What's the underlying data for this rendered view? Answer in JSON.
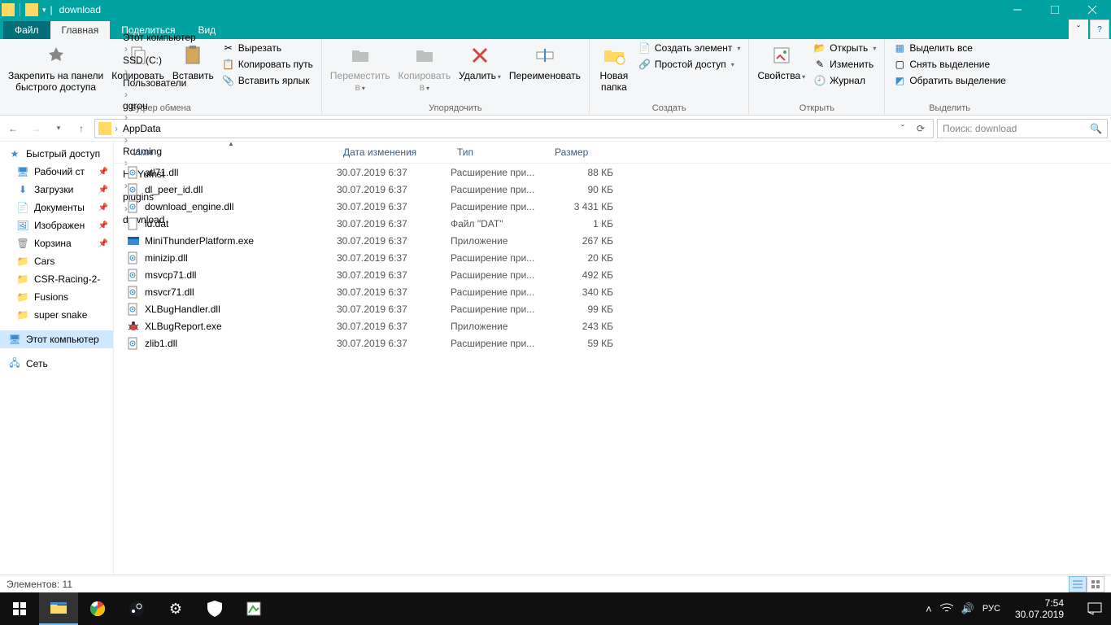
{
  "window": {
    "title": "download"
  },
  "tabs": {
    "file": "Файл",
    "home": "Главная",
    "share": "Поделиться",
    "view": "Вид"
  },
  "ribbon": {
    "clipboard": {
      "label": "Буфер обмена",
      "pin": "Закрепить на панели\nбыстрого доступа",
      "copy": "Копировать",
      "paste": "Вставить",
      "cut": "Вырезать",
      "copypath": "Копировать путь",
      "pasteshortcut": "Вставить ярлык"
    },
    "organize": {
      "label": "Упорядочить",
      "moveto": "Переместить\nв",
      "copyto": "Копировать\nв",
      "delete": "Удалить",
      "rename": "Переименовать"
    },
    "new": {
      "label": "Создать",
      "newfolder": "Новая\nпапка",
      "newitem": "Создать элемент",
      "easyaccess": "Простой доступ"
    },
    "open": {
      "label": "Открыть",
      "properties": "Свойства",
      "open": "Открыть",
      "edit": "Изменить",
      "history": "Журнал"
    },
    "select": {
      "label": "Выделить",
      "selectall": "Выделить все",
      "selectnone": "Снять выделение",
      "invert": "Обратить выделение"
    }
  },
  "breadcrumbs": [
    "Этот компьютер",
    "SSD (C:)",
    "Пользователи",
    "ggrou",
    "AppData",
    "Roaming",
    "HaiYuInst",
    "plugins",
    "download"
  ],
  "search": {
    "placeholder": "Поиск: download"
  },
  "sidebar": {
    "quickaccess": "Быстрый доступ",
    "items": [
      {
        "label": "Рабочий ст",
        "icon": "desktop",
        "pinned": true
      },
      {
        "label": "Загрузки",
        "icon": "downloads",
        "pinned": true
      },
      {
        "label": "Документы",
        "icon": "documents",
        "pinned": true
      },
      {
        "label": "Изображен",
        "icon": "pictures",
        "pinned": true
      },
      {
        "label": "Корзина",
        "icon": "recycle",
        "pinned": true
      },
      {
        "label": "Cars",
        "icon": "folder",
        "pinned": false
      },
      {
        "label": "CSR-Racing-2-",
        "icon": "folder",
        "pinned": false
      },
      {
        "label": "Fusions",
        "icon": "folder",
        "pinned": false
      },
      {
        "label": "super snake",
        "icon": "folder",
        "pinned": false
      }
    ],
    "thispc": "Этот компьютер",
    "network": "Сеть"
  },
  "columns": {
    "name": "Имя",
    "date": "Дата изменения",
    "type": "Тип",
    "size": "Размер"
  },
  "files": [
    {
      "name": "atl71.dll",
      "date": "30.07.2019 6:37",
      "type": "Расширение при...",
      "size": "88 КБ",
      "icon": "dll"
    },
    {
      "name": "dl_peer_id.dll",
      "date": "30.07.2019 6:37",
      "type": "Расширение при...",
      "size": "90 КБ",
      "icon": "dll"
    },
    {
      "name": "download_engine.dll",
      "date": "30.07.2019 6:37",
      "type": "Расширение при...",
      "size": "3 431 КБ",
      "icon": "dll"
    },
    {
      "name": "id.dat",
      "date": "30.07.2019 6:37",
      "type": "Файл \"DAT\"",
      "size": "1 КБ",
      "icon": "dat"
    },
    {
      "name": "MiniThunderPlatform.exe",
      "date": "30.07.2019 6:37",
      "type": "Приложение",
      "size": "267 КБ",
      "icon": "exe-blue"
    },
    {
      "name": "minizip.dll",
      "date": "30.07.2019 6:37",
      "type": "Расширение при...",
      "size": "20 КБ",
      "icon": "dll"
    },
    {
      "name": "msvcp71.dll",
      "date": "30.07.2019 6:37",
      "type": "Расширение при...",
      "size": "492 КБ",
      "icon": "dll"
    },
    {
      "name": "msvcr71.dll",
      "date": "30.07.2019 6:37",
      "type": "Расширение при...",
      "size": "340 КБ",
      "icon": "dll"
    },
    {
      "name": "XLBugHandler.dll",
      "date": "30.07.2019 6:37",
      "type": "Расширение при...",
      "size": "99 КБ",
      "icon": "dll"
    },
    {
      "name": "XLBugReport.exe",
      "date": "30.07.2019 6:37",
      "type": "Приложение",
      "size": "243 КБ",
      "icon": "exe-bug"
    },
    {
      "name": "zlib1.dll",
      "date": "30.07.2019 6:37",
      "type": "Расширение при...",
      "size": "59 КБ",
      "icon": "dll"
    }
  ],
  "status": {
    "items": "Элементов: 11"
  },
  "taskbar": {
    "time": "7:54",
    "date": "30.07.2019",
    "lang": "РУС"
  }
}
